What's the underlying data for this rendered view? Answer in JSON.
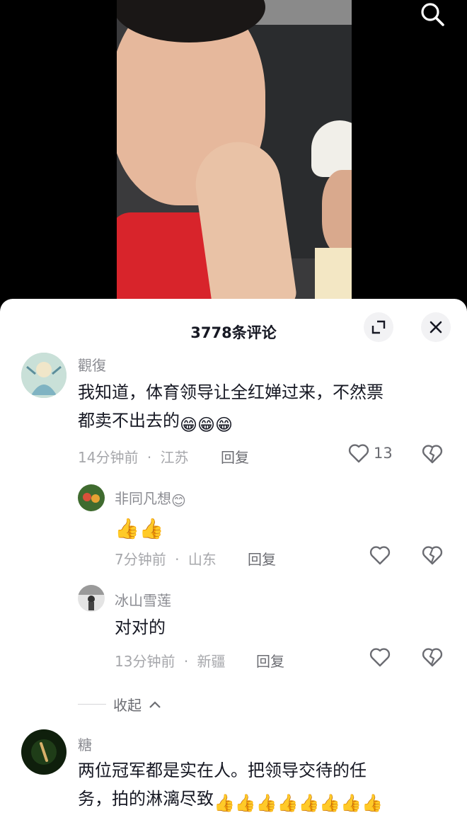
{
  "header": {
    "title": "3778条评论",
    "icons": {
      "search": "search-icon",
      "expand": "expand-icon",
      "close": "close-icon"
    }
  },
  "comments": [
    {
      "user": "觀復",
      "text_line1": "我知道，体育领导让全红婵过来，不然票",
      "text_line2": "都卖不出去的",
      "emojis": "😁😁😁",
      "time": "14分钟前",
      "sep": "·",
      "location": "江苏",
      "reply_label": "回复",
      "likes": "13"
    },
    {
      "user": "非同凡想",
      "user_emoji": "😊",
      "text": "👍👍",
      "time": "7分钟前",
      "sep": "·",
      "location": "山东",
      "reply_label": "回复"
    },
    {
      "user": "冰山雪莲",
      "text": "对对的",
      "time": "13分钟前",
      "sep": "·",
      "location": "新疆",
      "reply_label": "回复"
    },
    {
      "user": "糖",
      "text_line1": "两位冠军都是实在人。把领导交待的任",
      "text_line2": "务，拍的淋漓尽致",
      "emojis": "👍👍👍👍👍👍👍👍"
    }
  ],
  "collapse_label": "收起",
  "colors": {
    "accent_text": "#161823",
    "muted": "#a6a7ab",
    "panel_bg": "#ffffff"
  }
}
